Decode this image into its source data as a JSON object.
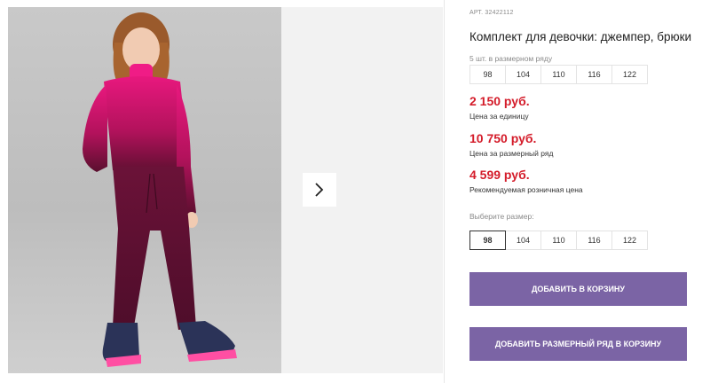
{
  "gallery": {
    "next_icon": "chevron-right-icon"
  },
  "product": {
    "article": "АРТ. 32422112",
    "title": "Комплект для девочки: джемпер, брюки",
    "series_label": "5 шт. в размерном ряду",
    "series_sizes": [
      "98",
      "104",
      "110",
      "116",
      "122"
    ],
    "prices": [
      {
        "value": "2 150 руб.",
        "caption": "Цена за единицу"
      },
      {
        "value": "10 750 руб.",
        "caption": "Цена за размерный ряд"
      },
      {
        "value": "4 599 руб.",
        "caption": "Рекомендуемая розничная цена"
      }
    ],
    "choose_size_label": "Выберите размер:",
    "choose_sizes": [
      "98",
      "104",
      "110",
      "116",
      "122"
    ],
    "selected_size": "98",
    "add_to_cart_label": "ДОБАВИТЬ В КОРЗИНУ",
    "add_series_label": "ДОБАВИТЬ РАЗМЕРНЫЙ РЯД В КОРЗИНУ"
  },
  "colors": {
    "accent_button": "#7b64a5",
    "price_red": "#d41c2a"
  }
}
